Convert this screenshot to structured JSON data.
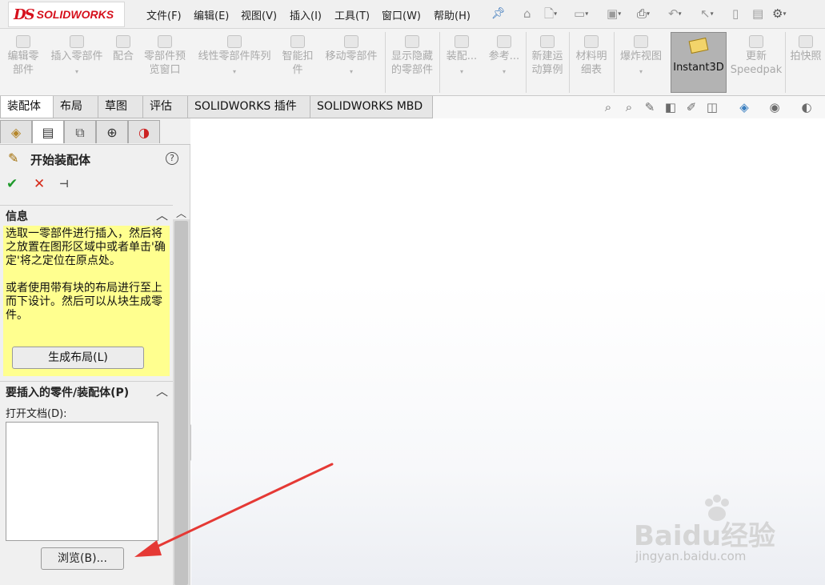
{
  "app": {
    "logo_text": "SOLIDWORKS",
    "logo_mark": "DS"
  },
  "menu": [
    "文件(F)",
    "编辑(E)",
    "视图(V)",
    "插入(I)",
    "工具(T)",
    "窗口(W)",
    "帮助(H)"
  ],
  "quick_access_icons": [
    "pin-icon",
    "home-icon",
    "new-document-icon",
    "open-folder-icon",
    "save-icon",
    "print-icon",
    "undo-icon",
    "select-pointer-icon",
    "rebuild-icon",
    "file-properties-icon",
    "options-gear-icon"
  ],
  "command_toolbar": {
    "items": [
      {
        "l1": "编辑零",
        "l2": "部件",
        "dd": false
      },
      {
        "l1": "插入零部件",
        "l2": "",
        "dd": true
      },
      {
        "l1": "配合",
        "l2": "",
        "dd": false
      },
      {
        "l1": "零部件预",
        "l2": "览窗口",
        "dd": false
      },
      {
        "l1": "线性零部件阵列",
        "l2": "",
        "dd": true
      },
      {
        "l1": "智能扣",
        "l2": "件",
        "dd": false
      },
      {
        "l1": "移动零部件",
        "l2": "",
        "dd": true
      },
      {
        "l1": "显示隐藏",
        "l2": "的零部件",
        "dd": false
      },
      {
        "l1": "装配...",
        "l2": "",
        "dd": true
      },
      {
        "l1": "参考...",
        "l2": "",
        "dd": true
      },
      {
        "l1": "新建运",
        "l2": "动算例",
        "dd": false
      },
      {
        "l1": "材料明",
        "l2": "细表",
        "dd": false
      },
      {
        "l1": "爆炸视图",
        "l2": "",
        "dd": true
      },
      {
        "l1": "更新",
        "l2": "Speedpak",
        "dd": false
      },
      {
        "l1": "拍快照",
        "l2": "",
        "dd": false
      }
    ],
    "instant3d": "Instant3D"
  },
  "tabs": [
    "装配体",
    "布局",
    "草图",
    "评估",
    "SOLIDWORKS 插件",
    "SOLIDWORKS MBD"
  ],
  "view_toolbar_icons": [
    "zoom-to-fit-icon",
    "zoom-area-icon",
    "previous-view-icon",
    "section-view-icon",
    "dynamic-annotation-icon",
    "view-orientation-icon",
    "display-style-icon",
    "hide-show-icon",
    "edit-appearance-icon"
  ],
  "panel": {
    "tab_icons": [
      "feature-manager-icon",
      "property-manager-icon",
      "configuration-manager-icon",
      "dimxpert-icon",
      "display-manager-icon"
    ],
    "title": "开始装配体",
    "help_glyph": "?",
    "info_section": {
      "title": "信息",
      "paragraph1": "选取一零部件进行插入，然后将之放置在图形区域中或者单击'确定'将之定位在原点处。",
      "paragraph2": "或者使用带有块的布局进行至上而下设计。然后可以从块生成零件。",
      "button": "生成布局(L)"
    },
    "insert_section": {
      "title": "要插入的零件/装配体(P)",
      "open_docs_label": "打开文档(D):",
      "browse_button": "浏览(B)..."
    }
  },
  "watermark": {
    "main": "Baidu经验",
    "sub": "jingyan.baidu.com"
  }
}
